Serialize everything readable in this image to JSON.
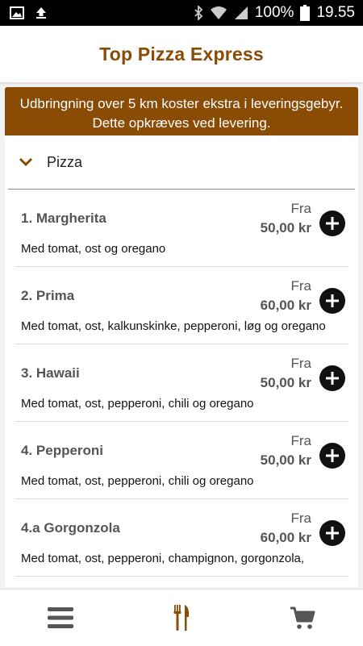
{
  "status_bar": {
    "battery_percent": "100%",
    "time": "19.55",
    "icons": [
      "image-icon",
      "upload-icon",
      "bluetooth-icon",
      "wifi-icon",
      "signal-icon",
      "battery-icon"
    ]
  },
  "header": {
    "title": "Top Pizza Express"
  },
  "banner": {
    "text": "Udbringning over 5 km koster ekstra i leveringsgebyr. Dette opkræves ved levering."
  },
  "category": {
    "label": "Pizza",
    "icon": "chevron-down-icon"
  },
  "items": [
    {
      "name": "1. Margherita",
      "price_prefix": "Fra",
      "price": "50,00 kr",
      "description": "Med tomat, ost og oregano"
    },
    {
      "name": "2. Prima",
      "price_prefix": "Fra",
      "price": "60,00 kr",
      "description": "Med tomat, ost, kalkunskinke, pepperoni, løg og oregano"
    },
    {
      "name": "3. Hawaii",
      "price_prefix": "Fra",
      "price": "50,00 kr",
      "description": "Med tomat, ost, pepperoni, chili og oregano"
    },
    {
      "name": "4. Pepperoni",
      "price_prefix": "Fra",
      "price": "50,00 kr",
      "description": "Med tomat, ost, pepperoni, chili og oregano"
    },
    {
      "name": "4.a Gorgonzola",
      "price_prefix": "Fra",
      "price": "60,00 kr",
      "description": "Med tomat, ost, pepperoni, champignon, gorgonzola,"
    }
  ],
  "bottom_nav": [
    {
      "icon": "menu-icon"
    },
    {
      "icon": "cutlery-icon",
      "active": true
    },
    {
      "icon": "cart-icon"
    }
  ],
  "colors": {
    "brand": "#8a4b05",
    "nav_icon": "#555555"
  }
}
